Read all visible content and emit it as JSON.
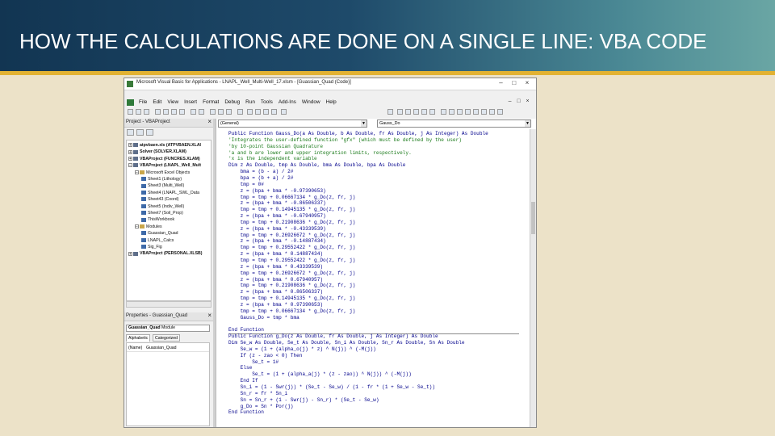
{
  "slide": {
    "title": "HOW THE CALCULATIONS ARE DONE ON A SINGLE LINE: VBA CODE"
  },
  "window": {
    "title": "Microsoft Visual Basic for Applications - LNAPL_Well_Multi-Well_17.xlsm - [Guassian_Quad (Code)]",
    "buttons": [
      "–",
      "□",
      "×"
    ]
  },
  "menu": {
    "items": [
      "File",
      "Edit",
      "View",
      "Insert",
      "Format",
      "Debug",
      "Run",
      "Tools",
      "Add-Ins",
      "Window",
      "Help"
    ]
  },
  "project_panel": {
    "title": "Project - VBAProject",
    "tree": [
      {
        "label": "atpvbaen.xls (ATPVBAEN.XLAI",
        "level": 0,
        "expander": "+"
      },
      {
        "label": "Solver (SOLVER.XLAM)",
        "level": 0,
        "expander": "+"
      },
      {
        "label": "VBAProject (FUNCRES.XLAM)",
        "level": 0,
        "expander": "+"
      },
      {
        "label": "VBAProject (LNAPL_Well_Mult",
        "level": 0,
        "expander": "−"
      },
      {
        "label": "Microsoft Excel Objects",
        "level": 1,
        "expander": "−"
      },
      {
        "label": "Sheet1 (Lithology)",
        "level": 2,
        "expander": ""
      },
      {
        "label": "Sheet3 (Multi_Well)",
        "level": 2,
        "expander": ""
      },
      {
        "label": "Sheet4 (LNAPL_SWL_Data",
        "level": 2,
        "expander": ""
      },
      {
        "label": "Sheet43 (Coord)",
        "level": 2,
        "expander": ""
      },
      {
        "label": "Sheet5 (Indiv_Well)",
        "level": 2,
        "expander": ""
      },
      {
        "label": "Sheet7 (Soil_Prop)",
        "level": 2,
        "expander": ""
      },
      {
        "label": "ThisWorkbook",
        "level": 2,
        "expander": ""
      },
      {
        "label": "Modules",
        "level": 1,
        "expander": "−"
      },
      {
        "label": "Guassian_Quad",
        "level": 2,
        "expander": ""
      },
      {
        "label": "LNAPL_Calcs",
        "level": 2,
        "expander": ""
      },
      {
        "label": "Sig_Fig",
        "level": 2,
        "expander": ""
      },
      {
        "label": "VBAProject (PERSONAL.XLSB)",
        "level": 0,
        "expander": "+"
      }
    ]
  },
  "properties_panel": {
    "title": "Properties - Guassian_Quad",
    "object_name": "Guassian_Quad",
    "object_type": "Module",
    "tabs": [
      "Alphabetic",
      "Categorized"
    ],
    "rows": [
      {
        "name": "(Name)",
        "value": "Guassian_Quad"
      }
    ]
  },
  "code_window": {
    "object_combo": "(General)",
    "proc_combo": "Gauss_Do",
    "lines": [
      "Public Function Gauss_Do(a As Double, b As Double, fr As Double, j As Integer) As Double",
      "'Integrates the user-defined function \"gfx\" (which must be defined by the user)",
      "'by 10-point Gaussian Quadrature",
      "'a and b are lower and upper integration limits, respectively.",
      "'x is the independent variable",
      "Dim z As Double, tmp As Double, bma As Double, bpa As Double",
      "    bma = (b - a) / 2#",
      "    bpa = (b + a) / 2#",
      "    tmp = 0#",
      "    z = (bpa + bma * -0.97390653)",
      "    tmp = tmp + 0.06667134 * g_Do(z, fr, j)",
      "    z = (bpa + bma * -0.86506337)",
      "    tmp = tmp + 0.14945135 * g_Do(z, fr, j)",
      "    z = (bpa + bma * -0.67940957)",
      "    tmp = tmp + 0.21908636 * g_Do(z, fr, j)",
      "    z = (bpa + bma * -0.43339539)",
      "    tmp = tmp + 0.26926672 * g_Do(z, fr, j)",
      "    z = (bpa + bma * -0.14887434)",
      "    tmp = tmp + 0.29552422 * g_Do(z, fr, j)",
      "    z = (bpa + bma * 0.14887434)",
      "    tmp = tmp + 0.29552422 * g_Do(z, fr, j)",
      "    z = (bpa + bma * 0.43339539)",
      "    tmp = tmp + 0.26926672 * g_Do(z, fr, j)",
      "    z = (bpa + bma * 0.67940957)",
      "    tmp = tmp + 0.21908636 * g_Do(z, fr, j)",
      "    z = (bpa + bma * 0.86506337)",
      "    tmp = tmp + 0.14945135 * g_Do(z, fr, j)",
      "    z = (bpa + bma * 0.97390653)",
      "    tmp = tmp + 0.06667134 * g_Do(z, fr, j)",
      "    Gauss_Do = tmp * bma",
      "",
      "End Function",
      "Public Function g_Do(z As Double, fr As Double, j As Integer) As Double",
      "Dim Se_w As Double, Se_t As Double, Sn_i As Double, Sn_r As Double, Sn As Double",
      "    Se_w = (1 + (alpha_o(j) * z) ^ N(j)) ^ (-M(j))",
      "    If (z - zao < 0) Then",
      "        Se_t = 1#",
      "    Else",
      "        Se_t = (1 + (alpha_a(j) * (z - zao)) ^ N(j)) ^ (-M(j))",
      "    End If",
      "    Sn_i = (1 - Swr(j)) * (Se_t - Se_w) / (1 - fr * (1 + Se_w - Se_t))",
      "    Sn_r = fr * Sn_i",
      "    Sn = Sn_r + (1 - Swr(j) - Sn_r) * (Se_t - Se_w)",
      "    g_Do = Sn * Por(j)",
      "End Function"
    ]
  },
  "colors": {
    "banner_start": "#123552",
    "banner_end": "#6aa6a4",
    "accent_line": "#e2b232",
    "keyword": "#00008b",
    "comment": "#1a7a1a",
    "background": "#ece2c8"
  }
}
